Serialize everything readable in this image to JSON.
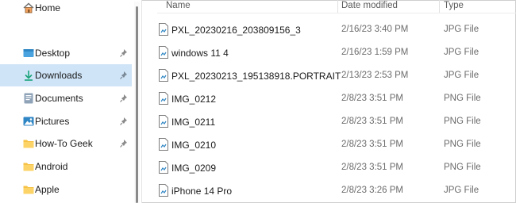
{
  "sidebar": {
    "items": [
      {
        "label": "Home",
        "icon": "home-icon",
        "pinned": false,
        "selected": false
      },
      {
        "label": "Desktop",
        "icon": "desktop-folder-icon",
        "pinned": true,
        "selected": false
      },
      {
        "label": "Downloads",
        "icon": "downloads-folder-icon",
        "pinned": true,
        "selected": true
      },
      {
        "label": "Documents",
        "icon": "documents-folder-icon",
        "pinned": true,
        "selected": false
      },
      {
        "label": "Pictures",
        "icon": "pictures-folder-icon",
        "pinned": true,
        "selected": false
      },
      {
        "label": "How-To Geek",
        "icon": "folder-icon",
        "pinned": true,
        "selected": false
      },
      {
        "label": "Android",
        "icon": "folder-icon",
        "pinned": false,
        "selected": false
      },
      {
        "label": "Apple",
        "icon": "folder-icon",
        "pinned": false,
        "selected": false
      }
    ]
  },
  "columns": {
    "name": "Name",
    "date": "Date modified",
    "type": "Type"
  },
  "files": [
    {
      "name": "PXL_20230216_203809156_3",
      "date": "2/16/23 3:40 PM",
      "type": "JPG File"
    },
    {
      "name": "windows 11 4",
      "date": "2/16/23 1:59 PM",
      "type": "JPG File"
    },
    {
      "name": "PXL_20230213_195138918.PORTRAIT",
      "date": "2/13/23 2:53 PM",
      "type": "JPG File"
    },
    {
      "name": "IMG_0212",
      "date": "2/8/23 3:51 PM",
      "type": "PNG File"
    },
    {
      "name": "IMG_0211",
      "date": "2/8/23 3:51 PM",
      "type": "PNG File"
    },
    {
      "name": "IMG_0210",
      "date": "2/8/23 3:51 PM",
      "type": "PNG File"
    },
    {
      "name": "IMG_0209",
      "date": "2/8/23 3:51 PM",
      "type": "PNG File"
    },
    {
      "name": "iPhone 14 Pro",
      "date": "2/8/23 3:26 PM",
      "type": "JPG File"
    }
  ],
  "colors": {
    "selected_bg": "#cfe4f7",
    "folder_yellow": "#f6c245",
    "accent_blue": "#1e88e5"
  }
}
